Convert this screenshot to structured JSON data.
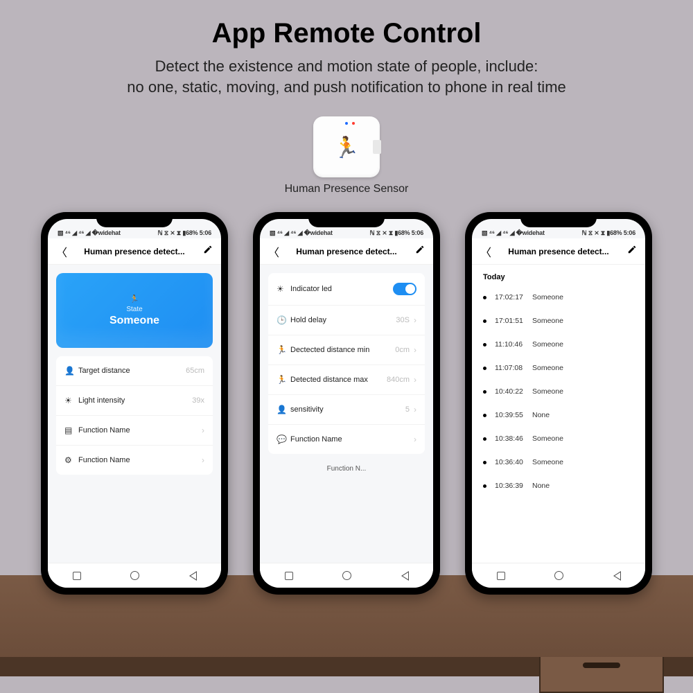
{
  "header": {
    "title": "App Remote Control",
    "sub1": "Detect the existence and motion state of people, include:",
    "sub2": "no one, static, moving, and push notification to phone in real time"
  },
  "sensor": {
    "label": "Human Presence Sensor"
  },
  "status": {
    "left": "▧ ⁴⁶ ◢ ⁴⁶ ◢ �widehat",
    "right": "ℕ ⧖ ⨯ ⧗ ▮68% 5:06"
  },
  "app": {
    "title": "Human presence detect..."
  },
  "screen1": {
    "state_label": "State",
    "state_value": "Someone",
    "rows": [
      {
        "icon": "person-icon",
        "glyph": "👤",
        "label": "Target distance",
        "value": "65cm"
      },
      {
        "icon": "light-icon",
        "glyph": "☀",
        "label": "Light intensity",
        "value": "39x"
      },
      {
        "icon": "doc-icon",
        "glyph": "▤",
        "label": "Function Name",
        "value": "",
        "chev": true
      },
      {
        "icon": "gear-icon",
        "glyph": "⚙",
        "label": "Function Name",
        "value": "",
        "chev": true
      }
    ]
  },
  "screen2": {
    "rows": [
      {
        "icon": "bulb-icon",
        "glyph": "☀",
        "label": "Indicator led",
        "toggle": true
      },
      {
        "icon": "clock-icon",
        "glyph": "🕒",
        "label": "Hold delay",
        "value": "30S",
        "chev": true
      },
      {
        "icon": "run-icon",
        "glyph": "🏃",
        "label": "Dectected distance min",
        "value": "0cm",
        "chev": true
      },
      {
        "icon": "run-icon",
        "glyph": "🏃",
        "label": "Detected distance max",
        "value": "840cm",
        "chev": true
      },
      {
        "icon": "person-icon",
        "glyph": "👤",
        "label": "sensitivity",
        "value": "5",
        "chev": true
      },
      {
        "icon": "chat-icon",
        "glyph": "💬",
        "label": "Function Name",
        "value": "",
        "chev": true
      }
    ],
    "footer": "Function N..."
  },
  "screen3": {
    "today": "Today",
    "events": [
      {
        "time": "17:02:17",
        "state": "Someone"
      },
      {
        "time": "17:01:51",
        "state": "Someone"
      },
      {
        "time": "11:10:46",
        "state": "Someone"
      },
      {
        "time": "11:07:08",
        "state": "Someone"
      },
      {
        "time": "10:40:22",
        "state": "Someone"
      },
      {
        "time": "10:39:55",
        "state": "None"
      },
      {
        "time": "10:38:46",
        "state": "Someone"
      },
      {
        "time": "10:36:40",
        "state": "Someone"
      },
      {
        "time": "10:36:39",
        "state": "None"
      }
    ]
  }
}
